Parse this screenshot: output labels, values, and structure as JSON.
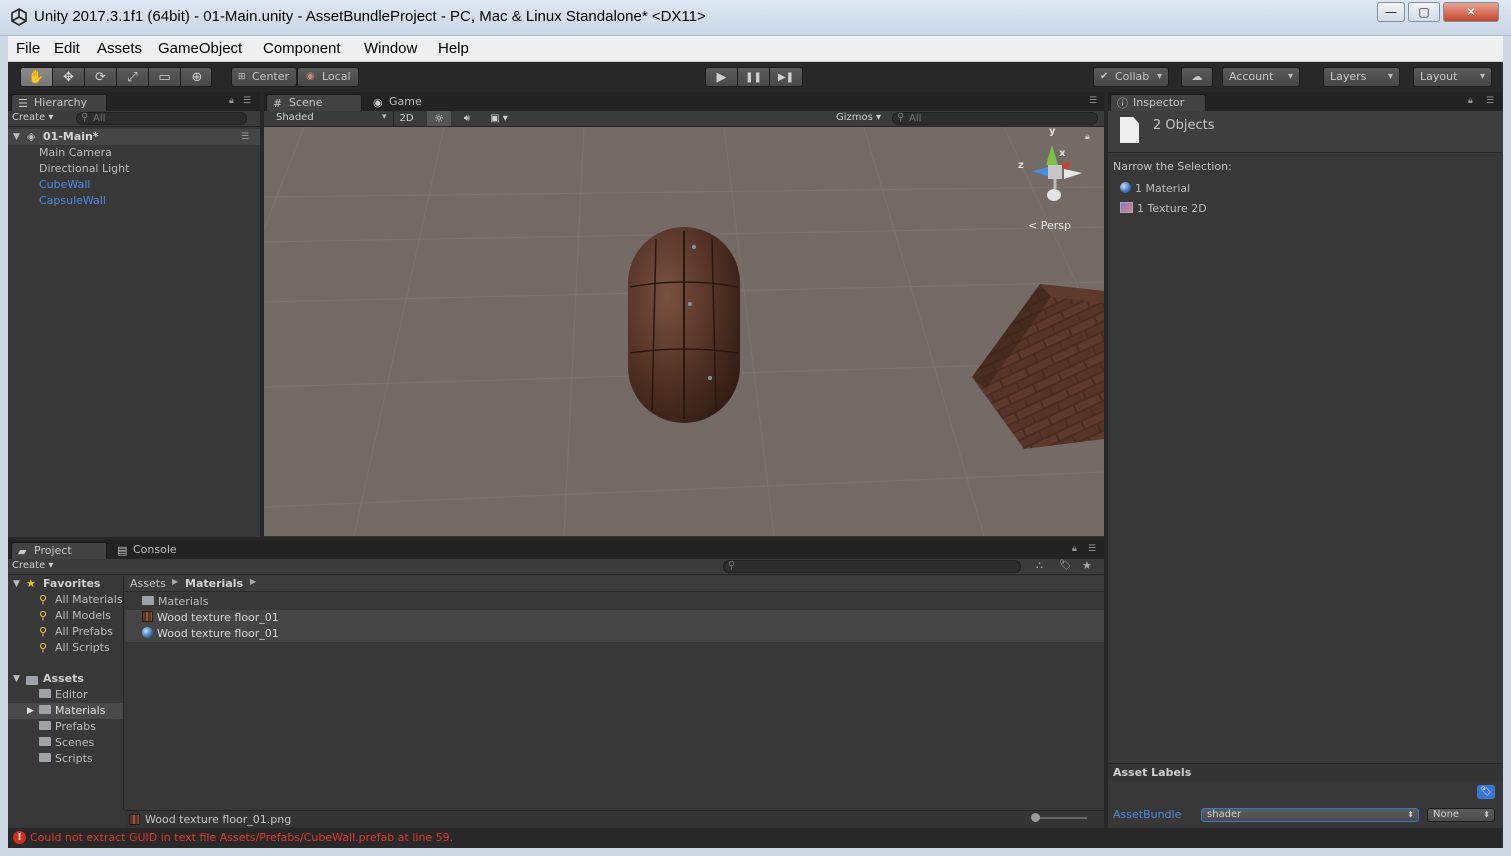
{
  "window": {
    "title": "Unity 2017.3.1f1 (64bit) - 01-Main.unity - AssetBundleProject - PC, Mac & Linux Standalone* <DX11>",
    "minimize": "—",
    "maximize": "▢",
    "close": "✕"
  },
  "menu": [
    "File",
    "Edit",
    "Assets",
    "GameObject",
    "Component",
    "Window",
    "Help"
  ],
  "toolbar": {
    "tools": [
      "✋",
      "✥",
      "⟳",
      "⤢",
      "▭",
      "⊕"
    ],
    "pivot": "Center",
    "space": "Local",
    "play": "▶",
    "pause": "❚❚",
    "step": "▶❚",
    "collab": "Collab",
    "cloud": "☁",
    "account": "Account",
    "layers": "Layers",
    "layout": "Layout"
  },
  "hierarchy": {
    "tab": "Hierarchy",
    "create": "Create",
    "search_placeholder": "All",
    "scene": "01-Main*",
    "items": [
      {
        "label": "Main Camera",
        "prefab": false
      },
      {
        "label": "Directional Light",
        "prefab": false
      },
      {
        "label": "CubeWall",
        "prefab": true
      },
      {
        "label": "CapsuleWall",
        "prefab": true
      }
    ]
  },
  "scene": {
    "tab_scene": "Scene",
    "tab_game": "Game",
    "shading": "Shaded",
    "mode_2d": "2D",
    "gizmos": "Gizmos",
    "search_placeholder": "All",
    "persp": "Persp",
    "axis_y": "y",
    "axis_z": "z",
    "axis_x": "x"
  },
  "inspector": {
    "tab": "Inspector",
    "objects": "2 Objects",
    "narrow": "Narrow the Selection:",
    "items": [
      "1 Material",
      "1 Texture 2D"
    ],
    "asset_labels": "Asset Labels",
    "assetbundle_label": "AssetBundle",
    "assetbundle_value": "shader",
    "variant_value": "None"
  },
  "project": {
    "tab": "Project",
    "console_tab": "Console",
    "create": "Create",
    "favorites_label": "Favorites",
    "favorites": [
      "All Materials",
      "All Models",
      "All Prefabs",
      "All Scripts"
    ],
    "assets_label": "Assets",
    "folders": [
      "Editor",
      "Materials",
      "Prefabs",
      "Scenes",
      "Scripts"
    ],
    "breadcrumb": [
      "Assets",
      "Materials"
    ],
    "files": [
      {
        "label": "Materials",
        "kind": "folder"
      },
      {
        "label": "Wood texture floor_01",
        "kind": "texture"
      },
      {
        "label": "Wood texture floor_01",
        "kind": "material"
      }
    ],
    "selected_path": "Wood texture floor_01.png"
  },
  "status": {
    "icon": "!",
    "message": "Could not extract GUID in text file Assets/Prefabs/CubeWall.prefab at line 59."
  }
}
